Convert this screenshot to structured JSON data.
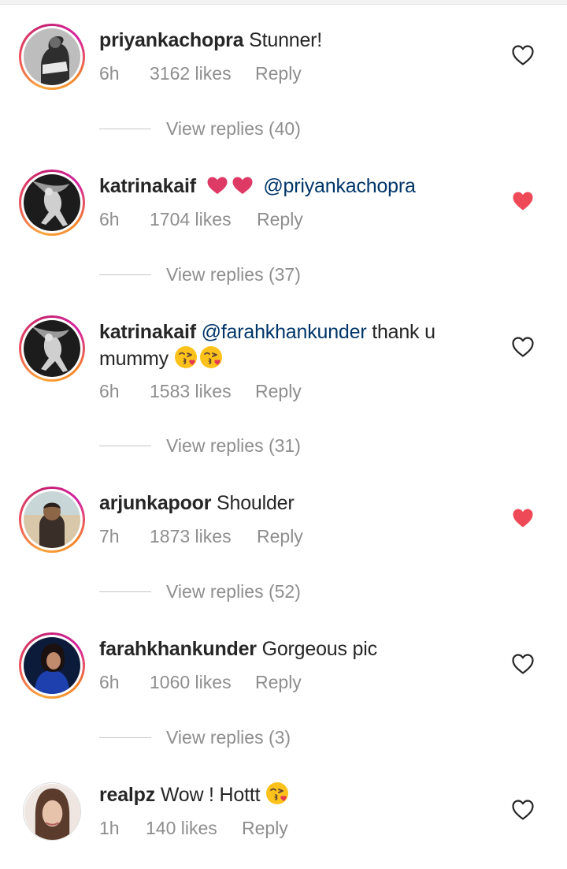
{
  "comments": [
    {
      "username": "priyankachopra",
      "text": "Stunner!",
      "time": "6h",
      "likes": "3162 likes",
      "reply": "Reply",
      "liked": false,
      "view_replies": "View replies (40)"
    },
    {
      "username": "katrinakaif",
      "mention": "@priyankachopra",
      "time": "6h",
      "likes": "1704 likes",
      "reply": "Reply",
      "liked": true,
      "view_replies": "View replies (37)"
    },
    {
      "username": "katrinakaif",
      "mention": "@farahkhankunder",
      "text": "thank u mummy",
      "time": "6h",
      "likes": "1583 likes",
      "reply": "Reply",
      "liked": false,
      "view_replies": "View replies (31)"
    },
    {
      "username": "arjunkapoor",
      "text": "Shoulder",
      "time": "7h",
      "likes": "1873 likes",
      "reply": "Reply",
      "liked": true,
      "view_replies": "View replies (52)"
    },
    {
      "username": "farahkhankunder",
      "text": "Gorgeous pic",
      "time": "6h",
      "likes": "1060 likes",
      "reply": "Reply",
      "liked": false,
      "view_replies": "View replies (3)"
    },
    {
      "username": "realpz",
      "text": "Wow ! Hottt",
      "time": "1h",
      "likes": "140 likes",
      "reply": "Reply",
      "liked": false
    }
  ],
  "colors": {
    "liked_heart": "#ed4956",
    "username": "#262626",
    "meta": "#8e8e8e",
    "mention": "#003569",
    "story_ring": "#d6249f"
  },
  "icons": {
    "like": "heart-outline-icon",
    "liked": "heart-filled-icon",
    "emoji": "kissing-face-emoji",
    "inline_heart": "red-heart-emoji"
  }
}
